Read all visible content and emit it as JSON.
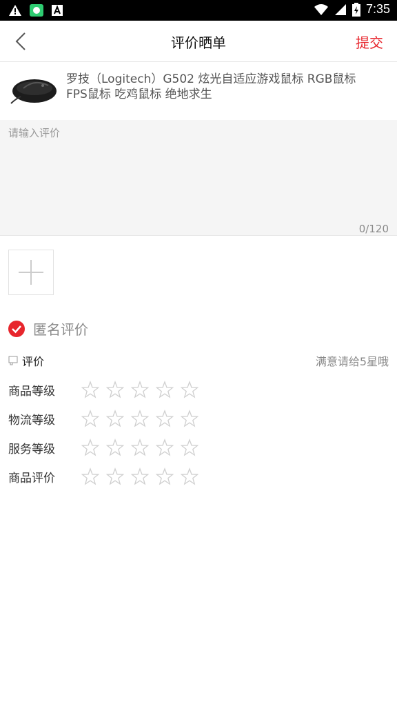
{
  "status_bar": {
    "time": "7:35",
    "icons": [
      "warning-icon",
      "app-icon",
      "font-icon",
      "wifi-icon",
      "signal-icon",
      "battery-icon"
    ]
  },
  "header": {
    "title": "评价晒单",
    "submit_label": "提交"
  },
  "product": {
    "name": "罗技（Logitech）G502 炫光自适应游戏鼠标 RGB鼠标 FPS鼠标 吃鸡鼠标 绝地求生"
  },
  "review": {
    "placeholder": "请输入评价",
    "counter": "0/120"
  },
  "anonymous": {
    "label": "匿名评价",
    "checked": true
  },
  "rating": {
    "title": "评价",
    "hint": "满意请给5星哦",
    "rows": [
      {
        "label": "商品等级",
        "stars": 0,
        "max": 5
      },
      {
        "label": "物流等级",
        "stars": 0,
        "max": 5
      },
      {
        "label": "服务等级",
        "stars": 0,
        "max": 5
      },
      {
        "label": "商品评价",
        "stars": 0,
        "max": 5
      }
    ]
  },
  "colors": {
    "accent": "#e7262d",
    "star_outline": "#cfcfcf"
  }
}
